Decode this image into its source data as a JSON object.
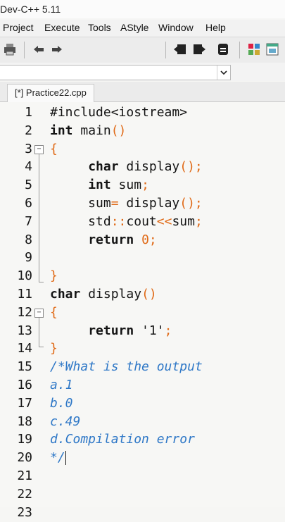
{
  "window": {
    "title": "Dev-C++ 5.11"
  },
  "menu": [
    "Project",
    "Execute",
    "Tools",
    "AStyle",
    "Window",
    "Help"
  ],
  "tab": {
    "label": "[*] Practice22.cpp"
  },
  "code": {
    "lines": [
      {
        "n": "1",
        "segs": [
          {
            "t": "#include<iostream>"
          }
        ]
      },
      {
        "n": "2",
        "segs": [
          {
            "t": "int",
            "k": "kw"
          },
          {
            "t": " main"
          },
          {
            "t": "()",
            "k": "or"
          }
        ]
      },
      {
        "n": "3",
        "segs": [
          {
            "t": "{",
            "k": "or"
          }
        ]
      },
      {
        "n": "4",
        "segs": [
          {
            "t": "     "
          },
          {
            "t": "char",
            "k": "kw"
          },
          {
            "t": " display"
          },
          {
            "t": "();",
            "k": "or"
          }
        ]
      },
      {
        "n": "5",
        "segs": [
          {
            "t": "     "
          },
          {
            "t": "int",
            "k": "kw"
          },
          {
            "t": " sum"
          },
          {
            "t": ";",
            "k": "or"
          }
        ]
      },
      {
        "n": "6",
        "segs": [
          {
            "t": "     sum"
          },
          {
            "t": "=",
            "k": "or"
          },
          {
            "t": " display"
          },
          {
            "t": "();",
            "k": "or"
          }
        ]
      },
      {
        "n": "7",
        "segs": [
          {
            "t": "     std"
          },
          {
            "t": "::",
            "k": "or"
          },
          {
            "t": "cout"
          },
          {
            "t": "<<",
            "k": "or"
          },
          {
            "t": "sum"
          },
          {
            "t": ";",
            "k": "or"
          }
        ]
      },
      {
        "n": "8",
        "segs": [
          {
            "t": "     "
          },
          {
            "t": "return",
            "k": "kw"
          },
          {
            "t": " "
          },
          {
            "t": "0;",
            "k": "or"
          }
        ]
      },
      {
        "n": "9",
        "segs": []
      },
      {
        "n": "10",
        "segs": [
          {
            "t": "}",
            "k": "or"
          }
        ]
      },
      {
        "n": "11",
        "segs": [
          {
            "t": "char",
            "k": "kw"
          },
          {
            "t": " display"
          },
          {
            "t": "()",
            "k": "or"
          }
        ]
      },
      {
        "n": "12",
        "segs": [
          {
            "t": "{",
            "k": "or"
          }
        ]
      },
      {
        "n": "13",
        "segs": [
          {
            "t": "     "
          },
          {
            "t": "return",
            "k": "kw"
          },
          {
            "t": " '1'"
          },
          {
            "t": ";",
            "k": "or"
          }
        ]
      },
      {
        "n": "14",
        "segs": [
          {
            "t": "}",
            "k": "or"
          }
        ]
      },
      {
        "n": "15",
        "segs": [
          {
            "t": "/*What is the output",
            "k": "cm"
          }
        ]
      },
      {
        "n": "16",
        "segs": [
          {
            "t": "a.1",
            "k": "cm"
          }
        ]
      },
      {
        "n": "17",
        "segs": [
          {
            "t": "b.0",
            "k": "cm"
          }
        ]
      },
      {
        "n": "18",
        "segs": [
          {
            "t": "c.49",
            "k": "cm"
          }
        ]
      },
      {
        "n": "19",
        "segs": [
          {
            "t": "d.Compilation error",
            "k": "cm"
          }
        ]
      },
      {
        "n": "20",
        "segs": [
          {
            "t": "*/",
            "k": "cm"
          }
        ]
      },
      {
        "n": "21",
        "segs": []
      },
      {
        "n": "22",
        "segs": []
      },
      {
        "n": "23",
        "segs": []
      }
    ]
  }
}
